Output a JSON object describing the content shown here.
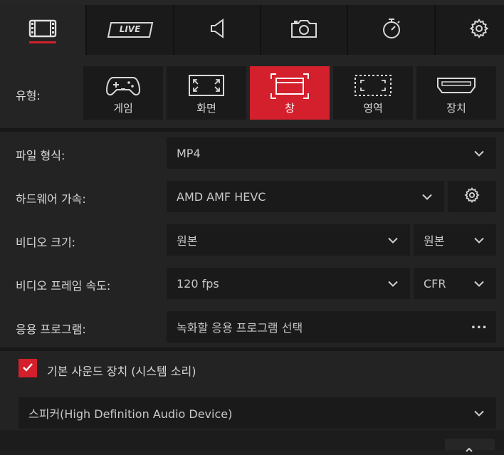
{
  "tabs": [
    {
      "name": "video-tab",
      "icon": "film-icon",
      "label": ""
    },
    {
      "name": "live-tab",
      "icon": "live-icon",
      "label": "LIVE"
    },
    {
      "name": "audio-tab",
      "icon": "speaker-icon",
      "label": ""
    },
    {
      "name": "screenshot-tab",
      "icon": "camera-icon",
      "label": ""
    },
    {
      "name": "timer-tab",
      "icon": "stopwatch-icon",
      "label": ""
    },
    {
      "name": "settings-tab",
      "icon": "gear-icon",
      "label": ""
    }
  ],
  "type_section": {
    "label": "유형:",
    "options": [
      {
        "label": "게임",
        "icon": "gamepad-icon"
      },
      {
        "label": "화면",
        "icon": "fullscreen-icon"
      },
      {
        "label": "창",
        "icon": "window-icon",
        "selected": true
      },
      {
        "label": "영역",
        "icon": "region-icon"
      },
      {
        "label": "장치",
        "icon": "hdmi-icon"
      }
    ]
  },
  "settings": {
    "file_format": {
      "label": "파일 형식:",
      "value": "MP4"
    },
    "hw_accel": {
      "label": "하드웨어 가속:",
      "value": "AMD AMF HEVC"
    },
    "video_size": {
      "label": "비디오 크기:",
      "value": "원본",
      "value2": "원본"
    },
    "frame_rate": {
      "label": "비디오 프레임 속도:",
      "value": "120 fps",
      "value2": "CFR"
    },
    "application": {
      "label": "응용 프로그램:",
      "value": "녹화할 응용 프로그램 선택",
      "more": "..."
    }
  },
  "audio": {
    "default_device_label": "기본 사운드 장치 (시스템 소리)",
    "default_device_checked": true,
    "device_value": "스피커(High Definition Audio Device)"
  },
  "colors": {
    "accent": "#d3202c",
    "bg": "#232323",
    "field": "#1a1a1a"
  }
}
